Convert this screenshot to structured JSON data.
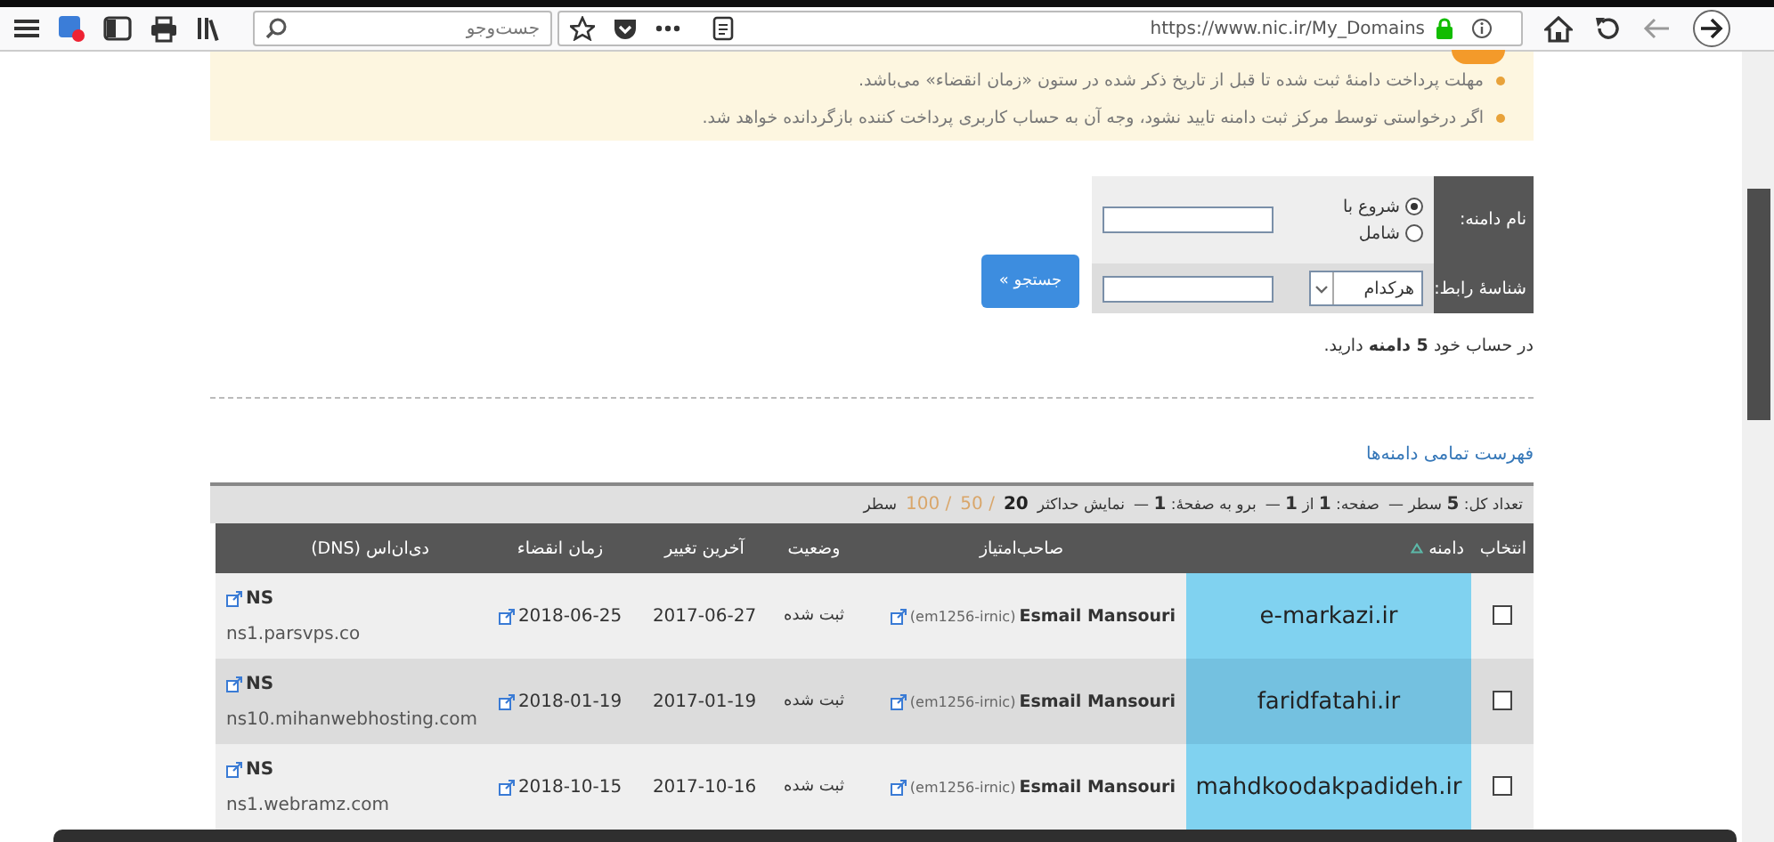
{
  "browser_toolbar": {
    "search": {
      "placeholder": "جست‌وجو"
    },
    "url": "https://www.nic.ir/My_Domains"
  },
  "notice": {
    "items": [
      "مهلت پرداخت دامنهٔ ثبت شده تا قبل از تاریخ ذکر شده در ستون «زمان انقضاء» می‌باشد.",
      "اگر درخواستی توسط مرکز ثبت دامنه تایید نشود، وجه آن به حساب کاربری پرداخت کننده بازگردانده خواهد شد."
    ]
  },
  "search_form": {
    "rows": [
      {
        "label": "نام دامنه:",
        "kind": "radio",
        "options": [
          {
            "label": "شروع با",
            "selected": true
          },
          {
            "label": "شامل",
            "selected": false
          }
        ]
      },
      {
        "label": "شناسهٔ رابط:",
        "kind": "select",
        "value": "هرکدام"
      }
    ],
    "button": "جستجو »"
  },
  "summary": "در حساب خود **5 دامنه** دارید.",
  "list_title": "فهرست تمامی دامنه‌ها",
  "table": {
    "info": {
      "segments": [
        "تعداد کل: **5** سطر —",
        "صفحه: **1** از **1** —",
        "برو به صفحهٔ: **1** —"
      ],
      "page_size": {
        "label": "نمایش حداکثر",
        "options": [
          {
            "label": "20",
            "selected": true
          },
          {
            "label": "/ 50",
            "selected": false
          },
          {
            "label": "/ 100",
            "selected": false
          }
        ],
        "suffix": "سطر"
      }
    },
    "columns": [
      {
        "label": "انتخاب"
      },
      {
        "label": "دامنه",
        "sorted": true
      },
      {
        "label": "صاحب‌امتیاز"
      },
      {
        "label": "وضعیت"
      },
      {
        "label": "آخرین تغییر"
      },
      {
        "label": "زمان انقضاء"
      },
      {
        "label": "دی‌ان‌اس (DNS)"
      }
    ],
    "rows": [
      {
        "checked": false,
        "domain": "e-markazi.ir",
        "owner": "Esmail Mansouri",
        "handle": "(em1256-irnic)",
        "status": "ثبت شده",
        "changed": "2017-06-27",
        "expires": "2018-06-25",
        "dns_label": "NS",
        "dns_server": "ns1.parsvps.co"
      },
      {
        "checked": false,
        "domain": "faridfatahi.ir",
        "owner": "Esmail Mansouri",
        "handle": "(em1256-irnic)",
        "status": "ثبت شده",
        "changed": "2017-01-19",
        "expires": "2018-01-19",
        "dns_label": "NS",
        "dns_server": "ns10.mihanwebhosting.com"
      },
      {
        "checked": false,
        "domain": "mahdkoodakpadideh.ir",
        "owner": "Esmail Mansouri",
        "handle": "(em1256-irnic)",
        "status": "ثبت شده",
        "changed": "2017-10-16",
        "expires": "2018-10-15",
        "dns_label": "NS",
        "dns_server": "ns1.webramz.com"
      }
    ]
  }
}
